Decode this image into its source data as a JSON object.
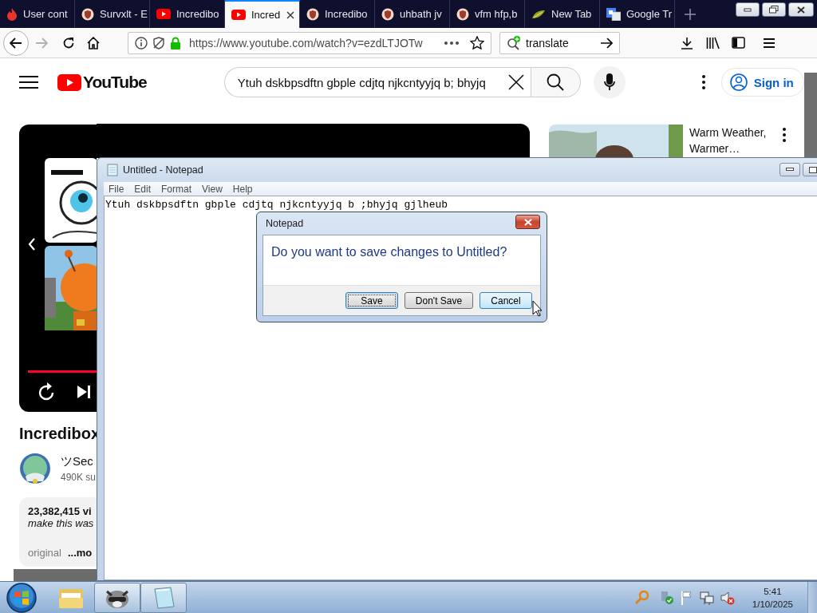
{
  "browser": {
    "tabs": [
      {
        "label": "User cont",
        "selected": false
      },
      {
        "label": "Survxlt - E",
        "selected": false
      },
      {
        "label": "Incredibo",
        "selected": false
      },
      {
        "label": "Incred",
        "selected": true
      },
      {
        "label": "Incredibo",
        "selected": false
      },
      {
        "label": "uhbath jv",
        "selected": false
      },
      {
        "label": "vfm hfp,b",
        "selected": false
      },
      {
        "label": "New Tab",
        "selected": false
      },
      {
        "label": "Google Tr",
        "selected": false
      }
    ],
    "url": "https://www.youtube.com/watch?v=ezdLTJOTw",
    "search": "translate"
  },
  "youtube": {
    "logo": "YouTube",
    "search_query": "Ytuh dskbpsdftn gbple cdjtq njkcntyyjq b; bhyjq",
    "sign_in": "Sign in",
    "video_title": "Incredibox",
    "channel": "ツSec",
    "subscribers": "490K su",
    "views": "23,382,415 vi",
    "description": "make this was",
    "tag": "original",
    "more": "...mo",
    "related": [
      {
        "title": "Warm Weather, Warmer…"
      }
    ]
  },
  "notepad": {
    "title": "Untitled - Notepad",
    "menu": [
      "File",
      "Edit",
      "Format",
      "View",
      "Help"
    ],
    "text": "Ytuh dskbpsdftn gbple cdjtq njkcntyyjq b ;bhyjq gjlheub"
  },
  "dialog": {
    "title": "Notepad",
    "message": "Do you want to save changes to Untitled?",
    "buttons": [
      {
        "label": "Save",
        "focused": true,
        "hovered": false
      },
      {
        "label": "Don't Save",
        "focused": false,
        "hovered": false
      },
      {
        "label": "Cancel",
        "focused": false,
        "hovered": true
      }
    ]
  },
  "taskbar": {
    "apps": [
      {
        "running": false
      },
      {
        "running": true
      },
      {
        "running": true
      }
    ],
    "time": "5:41",
    "date": "1/10/2025"
  }
}
